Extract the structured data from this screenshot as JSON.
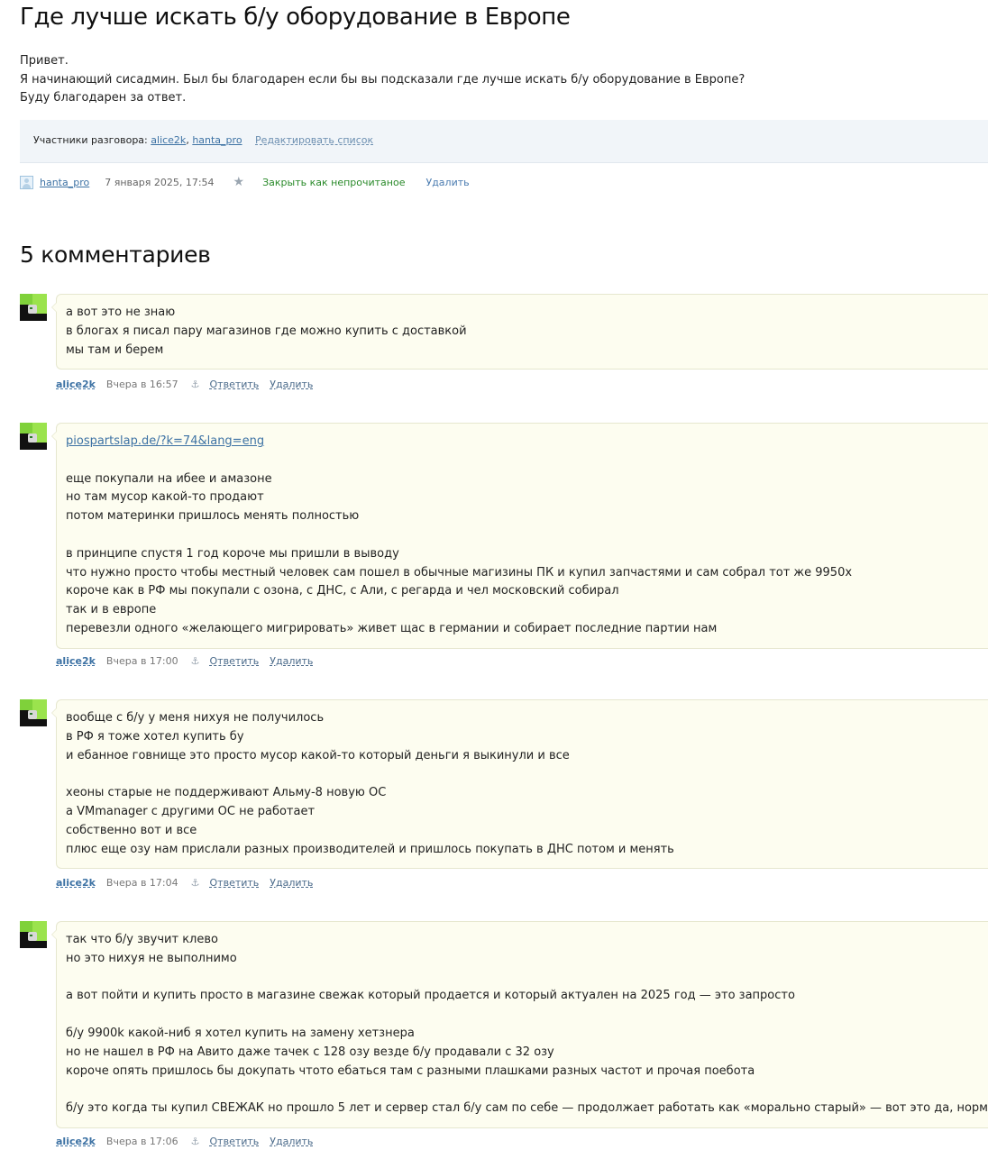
{
  "post": {
    "title": "Где лучше искать б/у оборудование в Европе",
    "body": [
      "Привет.",
      "Я начинающий сисадмин. Был бы благодарен если бы вы подсказали где лучше искать б/у оборудование в Европе?",
      "Буду благодарен за ответ."
    ],
    "participants_label": "Участники разговора:",
    "participants": [
      "alice2k",
      "hanta_pro"
    ],
    "edit_list_label": "Редактировать список",
    "author": "hanta_pro",
    "date": "7 января 2025, 17:54",
    "star_icon": "star-icon",
    "mark_unread_label": "Закрыть как непрочитаное",
    "delete_label": "Удалить"
  },
  "comments_title": "5 комментариев",
  "comments": [
    {
      "lines": [
        "а вот это не знаю",
        "в блогах я писал пару магазинов где можно купить с доставкой",
        "мы там и берем"
      ],
      "author": "alice2k",
      "time": "Вчера в 16:57",
      "reply": "Ответить",
      "delete": "Удалить"
    },
    {
      "link": "piospartslap.de/?k=74&lang=eng",
      "lines": [
        "",
        "еще покупали на ибее и амазоне",
        "но там мусор какой-то продают",
        "потом материнки пришлось менять полностью",
        "",
        "в принципе спустя 1 год короче мы пришли в выводу",
        "что нужно просто чтобы местный человек сам пошел в обычные магизины ПК и купил запчастями и сам собрал тот же 9950x",
        "короче как в РФ мы покупали с озона, с ДНС, с Али, с регарда и чел московский собирал",
        "так и в европе",
        "перевезли одного «желающего мигрировать» живет щас в германии и собирает последние партии нам"
      ],
      "author": "alice2k",
      "time": "Вчера в 17:00",
      "reply": "Ответить",
      "delete": "Удалить"
    },
    {
      "lines": [
        "вообще с б/у у меня нихуя не получилось",
        "в РФ я тоже хотел купить бу",
        "и ебанное говнище это просто мусор какой-то который деньги я выкинули и все",
        "",
        "хеоны старые не поддерживают Альму-8 новую ОС",
        "а VMmanager с другими ОС не работает",
        "собственно вот и все",
        "плюс еще озу нам прислали разных производителей и пришлось покупать в ДНС потом и менять"
      ],
      "author": "alice2k",
      "time": "Вчера в 17:04",
      "reply": "Ответить",
      "delete": "Удалить"
    },
    {
      "lines": [
        "так что б/у звучит клево",
        "но это нихуя не выполнимо",
        "",
        "а вот пойти и купить просто в магазине свежак который продается и который актуален на 2025 год — это запросто",
        "",
        "б/у 9900k какой-ниб я хотел купить на замену хетзнера",
        "но не нашел в РФ на Авито даже тачек с 128 озу везде б/у продавали с 32 озу",
        "короче опять пришлось бы докупать чтото ебаться там с разными плашками разных частот и прочая поебота",
        "",
        "б/у это когда ты купил СВЕЖАК но прошло 5 лет и сервер стал б/у сам по себе — продолжает работать как «морально старый» — вот это да, норм"
      ],
      "author": "alice2k",
      "time": "Вчера в 17:06",
      "reply": "Ответить",
      "delete": "Удалить"
    }
  ]
}
